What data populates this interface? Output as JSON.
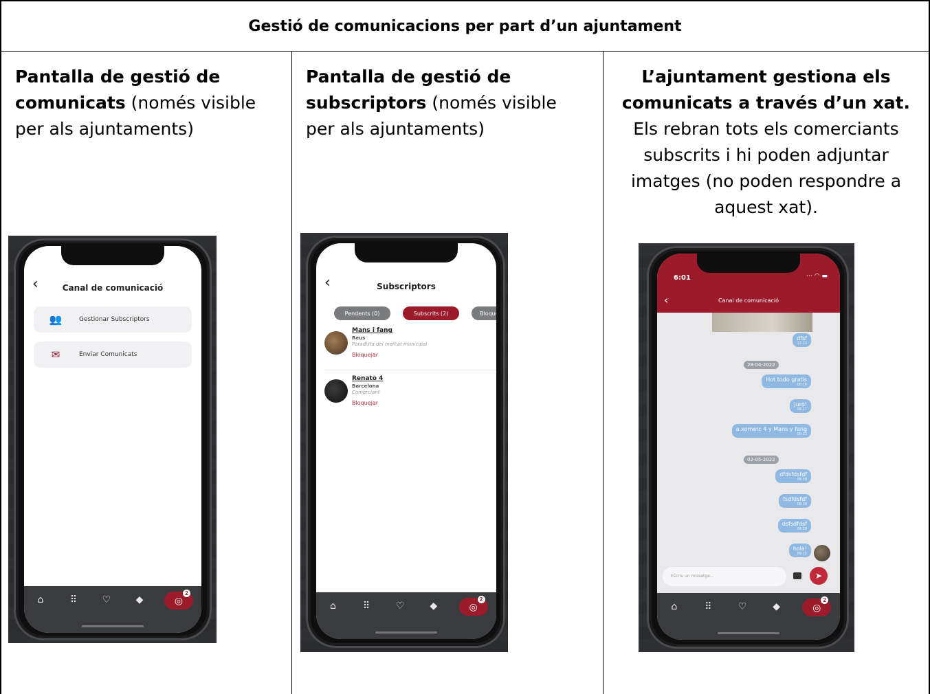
{
  "header": {
    "title": "Gestió de comunicacions per part d’un ajuntament"
  },
  "columns": [
    {
      "bold_text": "Pantalla de gestió de comunicats",
      "normal_text": " (només visible per als ajuntaments)"
    },
    {
      "bold_text": "Pantalla de gestió de subscriptors",
      "normal_text": " (només visible per als ajuntaments)"
    },
    {
      "bold_text": "L’ajuntament gestiona els comunicats a través d’un xat.",
      "normal_text": " Els rebran tots els comerciants subscrits i hi poden adjuntar imatges (no poden respondre a aquest xat)."
    }
  ],
  "screen1": {
    "title": "Canal de comunicació",
    "menu": [
      {
        "label": "Gestionar Subscriptors",
        "icon": "people-icon"
      },
      {
        "label": "Enviar Comunicats",
        "icon": "envelope-icon"
      }
    ]
  },
  "screen2": {
    "title": "Subscriptors",
    "tabs": [
      {
        "label": "Pendents (0)",
        "active": false
      },
      {
        "label": "Subscrits (2)",
        "active": true
      },
      {
        "label": "Bloque",
        "active": false
      }
    ],
    "subscribers": [
      {
        "name": "Mans i fang",
        "city": "Reus",
        "description": "Paradista del mercat municipal",
        "action": "Bloquejar"
      },
      {
        "name": "Renato 4",
        "city": "Barcelona",
        "description": "Comerciant",
        "action": "Bloquejar"
      }
    ]
  },
  "screen3": {
    "status_time": "6:01",
    "title": "Canal de comunicació",
    "messages": [
      {
        "text": "dfsf",
        "time": "17:13"
      },
      {
        "date": "28-04-2022"
      },
      {
        "text": "Hot todo gratis",
        "time": "08:16"
      },
      {
        "text": "Juro!",
        "time": "08:17"
      },
      {
        "text": "a xomerc 4 y Mans y fang",
        "time": "08:23"
      },
      {
        "date": "02-05-2022"
      },
      {
        "text": "dfdsfdsfdf",
        "time": "08:30"
      },
      {
        "text": "fsdfdsfdf",
        "time": "08:30"
      },
      {
        "text": "dsfsdfdsf",
        "time": "08:30"
      },
      {
        "text": "hola!",
        "time": "09:15"
      }
    ],
    "input_placeholder": "Escriu un missatge..."
  },
  "nav": {
    "badge": "2"
  },
  "colors": {
    "brand": "#9b1b2b",
    "bubble": "#8fb9e3",
    "nav_bg": "#3a3b3e"
  }
}
